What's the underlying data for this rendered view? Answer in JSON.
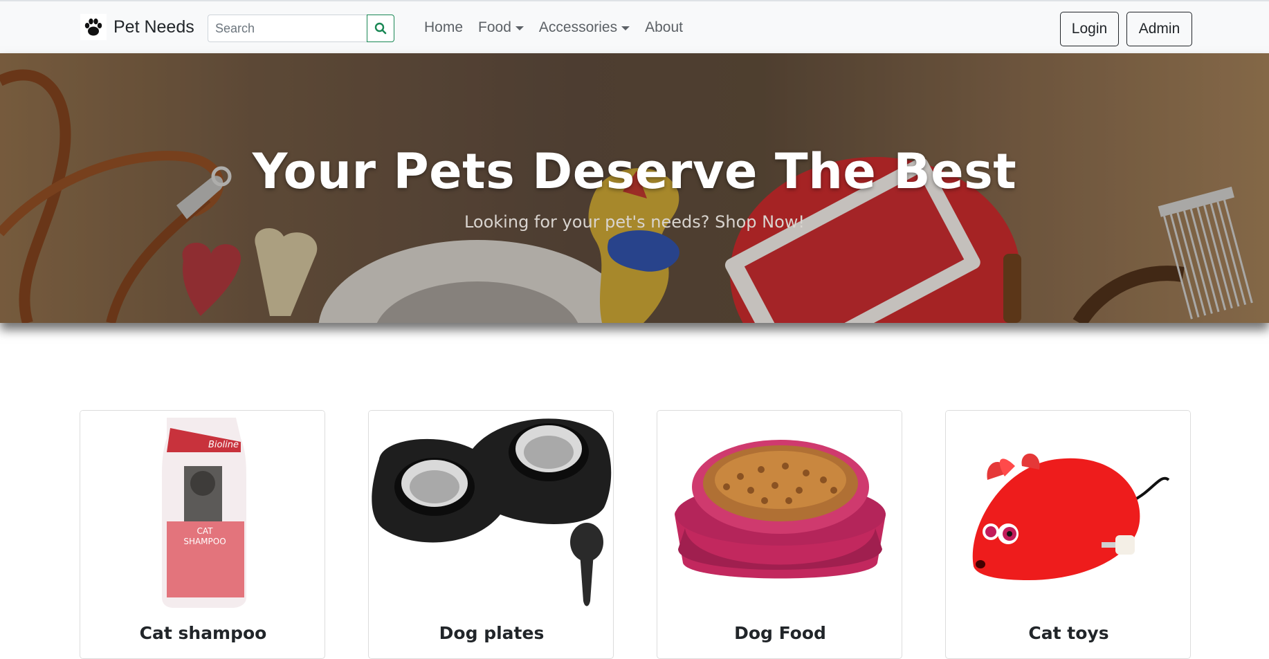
{
  "navbar": {
    "brand": "Pet Needs",
    "search_placeholder": "Search",
    "links": [
      {
        "label": "Home",
        "dropdown": false
      },
      {
        "label": "Food",
        "dropdown": true
      },
      {
        "label": "Accessories",
        "dropdown": true
      },
      {
        "label": "About",
        "dropdown": false
      }
    ],
    "login_label": "Login",
    "admin_label": "Admin"
  },
  "hero": {
    "title": "Your Pets Deserve The Best",
    "subtitle": "Looking for your pet's needs? Shop Now!"
  },
  "products": [
    {
      "name": "Cat shampoo",
      "image": "cat-shampoo-bottle"
    },
    {
      "name": "Dog plates",
      "image": "dog-plates-double-bowl"
    },
    {
      "name": "Dog Food",
      "image": "dog-food-bowl"
    },
    {
      "name": "Cat toys",
      "image": "red-mouse-toy"
    }
  ],
  "colors": {
    "navbar_bg": "#f8f9fa",
    "search_accent": "#198754",
    "text_dark": "#212529",
    "nav_link": "#5c6166"
  }
}
